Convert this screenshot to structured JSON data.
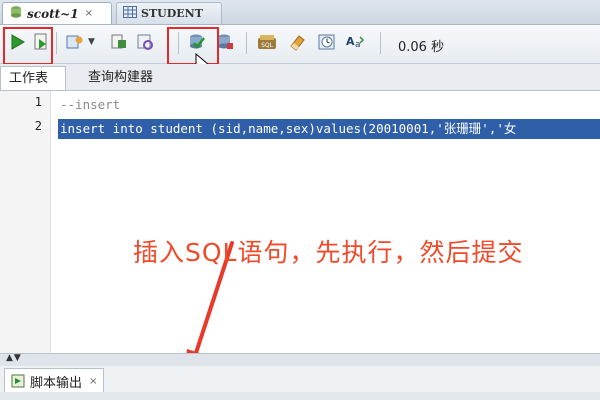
{
  "tabs": {
    "active_label": "scott~1",
    "inactive_label": "STUDENT",
    "close_glyph": "×"
  },
  "toolbar": {
    "buttons": [
      {
        "name": "run-statement-button",
        "icon": "play-icon"
      },
      {
        "name": "run-script-button",
        "icon": "script-icon"
      },
      {
        "name": "autotrace-button",
        "icon": "autotrace-icon"
      },
      {
        "name": "explain-plan-button",
        "icon": "explain-plan-icon"
      },
      {
        "name": "sql-tuning-button",
        "icon": "tuning-icon"
      },
      {
        "name": "commit-button",
        "icon": "commit-icon"
      },
      {
        "name": "rollback-button",
        "icon": "rollback-icon"
      },
      {
        "name": "sql-history-button",
        "icon": "history-icon"
      },
      {
        "name": "clear-button",
        "icon": "eraser-icon"
      },
      {
        "name": "sql-worksheet-button",
        "icon": "clock-icon"
      },
      {
        "name": "format-button",
        "icon": "case-toggle-icon"
      }
    ],
    "exec_time": "0.06 秒"
  },
  "subtabs": {
    "worksheet": "工作表",
    "query_builder": "查询构建器"
  },
  "editor": {
    "lines": [
      {
        "no": "1",
        "text": "--insert"
      },
      {
        "no": "2",
        "text": "insert into student (sid,name,sex)values(20010001,'张珊珊','女"
      }
    ]
  },
  "annotation": "插入SQL语句，先执行，然后提交",
  "bottom_panel": {
    "tab_label": "脚本输出",
    "close_glyph": "×",
    "splitter_glyph": "▲▼"
  },
  "colors": {
    "highlight_box": "#e12b2b",
    "selection": "#2f5fa8",
    "annotation_text": "#f04a2a"
  }
}
